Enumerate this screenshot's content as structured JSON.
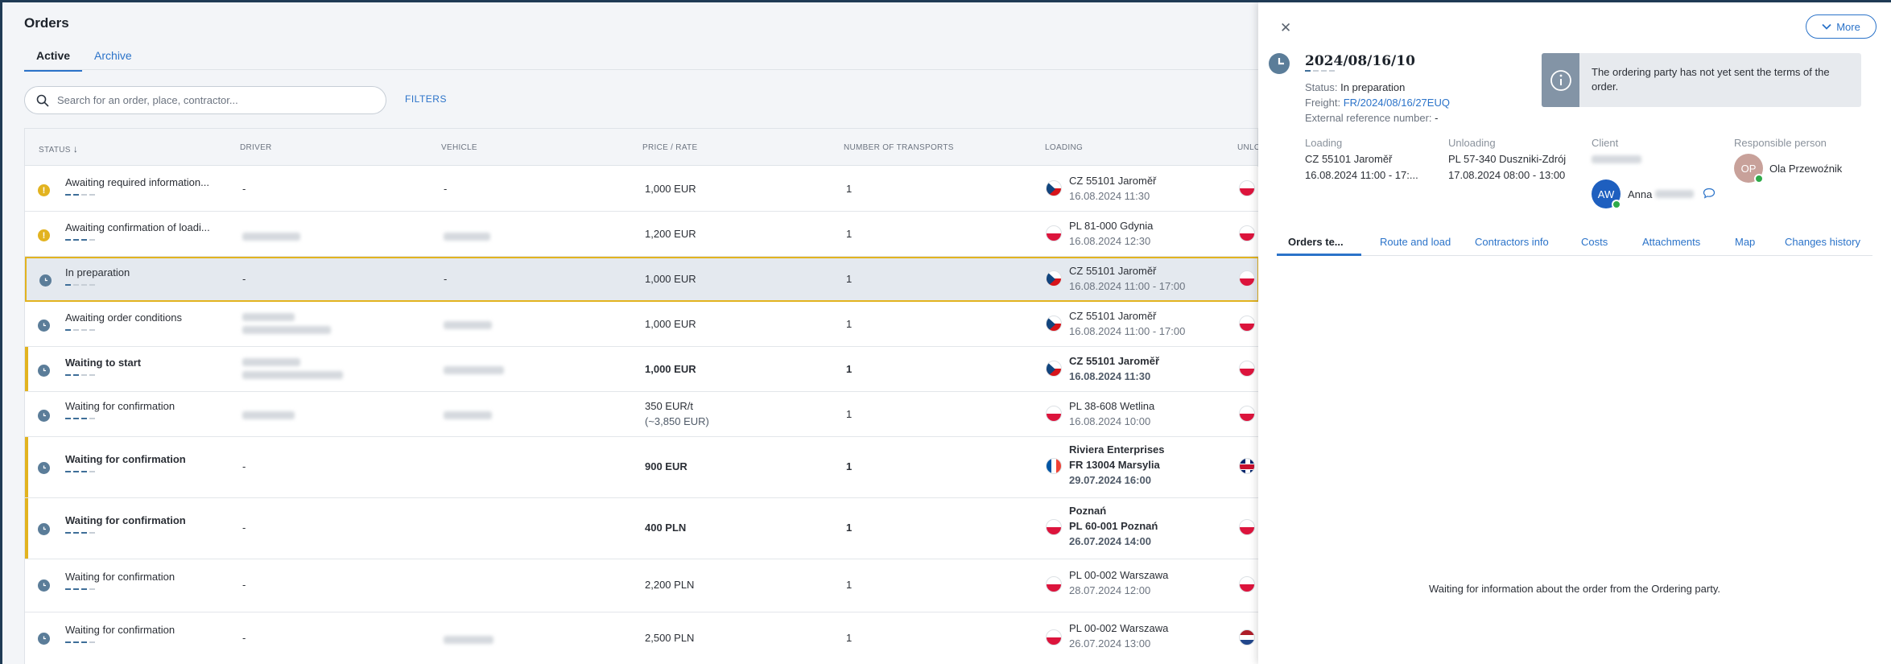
{
  "page": {
    "title": "Orders"
  },
  "tabs": [
    {
      "label": "Active"
    },
    {
      "label": "Archive"
    }
  ],
  "search": {
    "placeholder": "Search for an order, place, contractor..."
  },
  "filters_label": "FILTERS",
  "columns": {
    "status": "STATUS",
    "driver": "DRIVER",
    "vehicle": "VEHICLE",
    "price": "PRICE / RATE",
    "transports": "NUMBER OF TRANSPORTS",
    "loading": "LOADING",
    "unloading": "UNLO"
  },
  "rows": [
    {
      "status": "Awaiting required information...",
      "icon": "warning-icon",
      "driver": "-",
      "vehicle": "-",
      "price": "1,000 EUR",
      "price_sub": "",
      "transports": "1",
      "place_name": "",
      "place": "CZ 55101 Jaroměř",
      "date": "16.08.2024 11:30",
      "flag": "cz",
      "unload_flag": "pl"
    },
    {
      "status": "Awaiting confirmation of loadi...",
      "icon": "warning-icon",
      "driver": "",
      "vehicle": "",
      "price": "1,200 EUR",
      "price_sub": "",
      "transports": "1",
      "place_name": "",
      "place": "PL 81-000 Gdynia",
      "date": "16.08.2024 12:30",
      "flag": "pl",
      "unload_flag": "pl"
    },
    {
      "status": "In preparation",
      "icon": "clock-icon",
      "driver": "-",
      "vehicle": "-",
      "price": "1,000 EUR",
      "price_sub": "",
      "transports": "1",
      "place_name": "",
      "place": "CZ 55101 Jaroměř",
      "date": "16.08.2024 11:00 - 17:00",
      "flag": "cz",
      "unload_flag": "pl"
    },
    {
      "status": "Awaiting order conditions",
      "icon": "clock-icon",
      "driver": "",
      "vehicle": "",
      "price": "1,000 EUR",
      "price_sub": "",
      "transports": "1",
      "place_name": "",
      "place": "CZ 55101 Jaroměř",
      "date": "16.08.2024 11:00 - 17:00",
      "flag": "cz",
      "unload_flag": "pl"
    },
    {
      "status": "Waiting to start",
      "icon": "clock-icon",
      "driver": "",
      "vehicle": "",
      "price": "1,000 EUR",
      "price_sub": "",
      "transports": "1",
      "place_name": "",
      "place": "CZ 55101 Jaroměř",
      "date": "16.08.2024 11:30",
      "flag": "cz",
      "unload_flag": "pl"
    },
    {
      "status": "Waiting for confirmation",
      "icon": "clock-icon",
      "driver": "",
      "vehicle": "",
      "price": "350 EUR/t",
      "price_sub": "(~3,850 EUR)",
      "transports": "1",
      "place_name": "",
      "place": "PL 38-608 Wetlina",
      "date": "16.08.2024 10:00",
      "flag": "pl",
      "unload_flag": "pl"
    },
    {
      "status": "Waiting for confirmation",
      "icon": "clock-icon",
      "driver": "-",
      "vehicle": "",
      "price": "900 EUR",
      "price_sub": "",
      "transports": "1",
      "place_name": "Riviera Enterprises",
      "place": "FR 13004 Marsylia",
      "date": "29.07.2024 16:00",
      "flag": "fr",
      "unload_flag": "uk"
    },
    {
      "status": "Waiting for confirmation",
      "icon": "clock-icon",
      "driver": "-",
      "vehicle": "",
      "price": "400 PLN",
      "price_sub": "",
      "transports": "1",
      "place_name": "Poznań",
      "place": "PL 60-001 Poznań",
      "date": "26.07.2024 14:00",
      "flag": "pl",
      "unload_flag": "pl"
    },
    {
      "status": "Waiting for confirmation",
      "icon": "clock-icon",
      "driver": "-",
      "vehicle": "",
      "price": "2,200 PLN",
      "price_sub": "",
      "transports": "1",
      "place_name": "",
      "place": "PL 00-002 Warszawa",
      "date": "28.07.2024 12:00",
      "flag": "pl",
      "unload_flag": "pl"
    },
    {
      "status": "Waiting for confirmation",
      "icon": "clock-icon",
      "driver": "-",
      "vehicle": "",
      "price": "2,500 PLN",
      "price_sub": "",
      "transports": "1",
      "place_name": "",
      "place": "PL 00-002 Warszawa",
      "date": "26.07.2024 13:00",
      "flag": "pl",
      "unload_flag": "nl"
    }
  ],
  "panel": {
    "more_label": "More",
    "title": "2024/08/16/10",
    "status_label": "Status:",
    "status_value": "In preparation",
    "freight_label": "Freight:",
    "freight_value": "FR/2024/08/16/27EUQ",
    "extref_label": "External reference number:",
    "extref_value": "-",
    "info_text": "The ordering party has not yet sent the terms of the order.",
    "loading_label": "Loading",
    "loading_place": "CZ 55101 Jaroměř",
    "loading_time": "16.08.2024 11:00 - 17:...",
    "unloading_label": "Unloading",
    "unloading_place": "PL 57-340 Duszniki-Zdrój",
    "unloading_time": "17.08.2024 08:00 - 13:00",
    "client_label": "Client",
    "client_user_initials": "AW",
    "client_user_name": "Anna",
    "responsible_label": "Responsible person",
    "responsible_initials": "OP",
    "responsible_name": "Ola Przewoźnik",
    "tabs": [
      {
        "label": "Orders te..."
      },
      {
        "label": "Route and load"
      },
      {
        "label": "Contractors info"
      },
      {
        "label": "Costs"
      },
      {
        "label": "Attachments"
      },
      {
        "label": "Map"
      },
      {
        "label": "Changes history"
      }
    ],
    "empty_message": "Waiting for information about the order from the Ordering party."
  },
  "colors": {
    "accent": "#2b73c9",
    "highlight": "#e2b320",
    "status_clock": "#5b7d99"
  }
}
